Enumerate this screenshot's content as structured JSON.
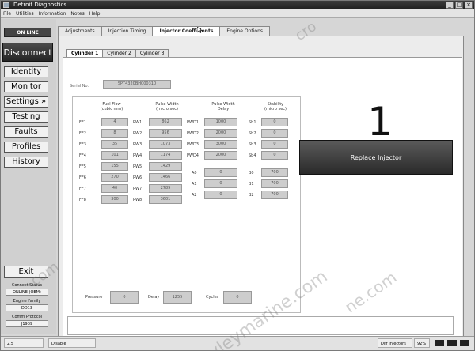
{
  "window": {
    "title": "Detroit Diagnostics",
    "buttons": [
      "_",
      "□",
      "×"
    ]
  },
  "menu": [
    "File",
    "Utilities",
    "Information",
    "Notes",
    "Help"
  ],
  "sidebar": {
    "status": "ON LINE",
    "disconnect": "Disconnect",
    "items": [
      "Identity",
      "Monitor",
      "Settings »",
      "Testing",
      "Faults",
      "Profiles",
      "History"
    ],
    "exit": "Exit",
    "info": [
      {
        "label": "Connect Status",
        "value": "ONLINE (OEM)"
      },
      {
        "label": "Engine Family",
        "value": "DD13"
      },
      {
        "label": "Comm Protocol",
        "value": "J1939"
      }
    ]
  },
  "main_tabs": [
    "Adjustments",
    "Injection Timing",
    "Injector Coefficients",
    "Engine Options"
  ],
  "active_main_tab": 2,
  "cylinder_tabs": [
    "Cylinder 1",
    "Cylinder 2",
    "Cylinder 3"
  ],
  "active_cylinder_tab": 0,
  "serial": {
    "label": "Serial No.",
    "value": "SPT4320BH000310"
  },
  "columns": {
    "fuel_flow": "Fuel Flow\n(cubic mm)",
    "pulse_width": "Pulse Width\n(micro sec)",
    "pulse_width_delay": "Pulse Width\nDelay",
    "stability": "Stability\n(micro sec)"
  },
  "fuel_flow_rows": [
    {
      "label": "FF1",
      "value": "4"
    },
    {
      "label": "FF2",
      "value": "8"
    },
    {
      "label": "FF3",
      "value": "35"
    },
    {
      "label": "FF4",
      "value": "101"
    },
    {
      "label": "FF5",
      "value": "155"
    },
    {
      "label": "FF6",
      "value": "270"
    },
    {
      "label": "FF7",
      "value": "40"
    },
    {
      "label": "FF8",
      "value": "300"
    }
  ],
  "pulse_width_rows": [
    {
      "label": "PW1",
      "value": "862"
    },
    {
      "label": "PW2",
      "value": "956"
    },
    {
      "label": "PW3",
      "value": "1073"
    },
    {
      "label": "PW4",
      "value": "1174"
    },
    {
      "label": "PW5",
      "value": "1429"
    },
    {
      "label": "PW6",
      "value": "1466"
    },
    {
      "label": "PW7",
      "value": "2789"
    },
    {
      "label": "PW8",
      "value": "3601"
    }
  ],
  "pwd_rows": [
    {
      "label": "PWD1",
      "value": "1000"
    },
    {
      "label": "PWD2",
      "value": "2000"
    },
    {
      "label": "PWD3",
      "value": "3000"
    },
    {
      "label": "PWD4",
      "value": "2000"
    }
  ],
  "a_rows": [
    {
      "label": "A0",
      "value": "0"
    },
    {
      "label": "A1",
      "value": "0"
    },
    {
      "label": "A2",
      "value": "0"
    }
  ],
  "stability_rows": [
    {
      "label": "Sb1",
      "value": "0"
    },
    {
      "label": "Sb2",
      "value": "0"
    },
    {
      "label": "Sb3",
      "value": "0"
    },
    {
      "label": "Sb4",
      "value": "0"
    }
  ],
  "b_rows": [
    {
      "label": "B0",
      "value": "700"
    },
    {
      "label": "B1",
      "value": "700"
    },
    {
      "label": "B2",
      "value": "700"
    }
  ],
  "bottom_fields": {
    "pressure_label": "Pressure",
    "pressure_value": "0",
    "delay_label": "Delay",
    "delay_value": "1255",
    "cycles_label": "Cycles",
    "cycles_value": "0"
  },
  "big_number": "1",
  "replace_button": "Replace Injector",
  "statusbar": {
    "left": "2.5",
    "mode": "Disable",
    "right_label": "Diff Injectors",
    "percent": "92%"
  },
  "watermarks": [
    "cro",
    "com",
    "ne.com",
    "yleymarine.com"
  ]
}
